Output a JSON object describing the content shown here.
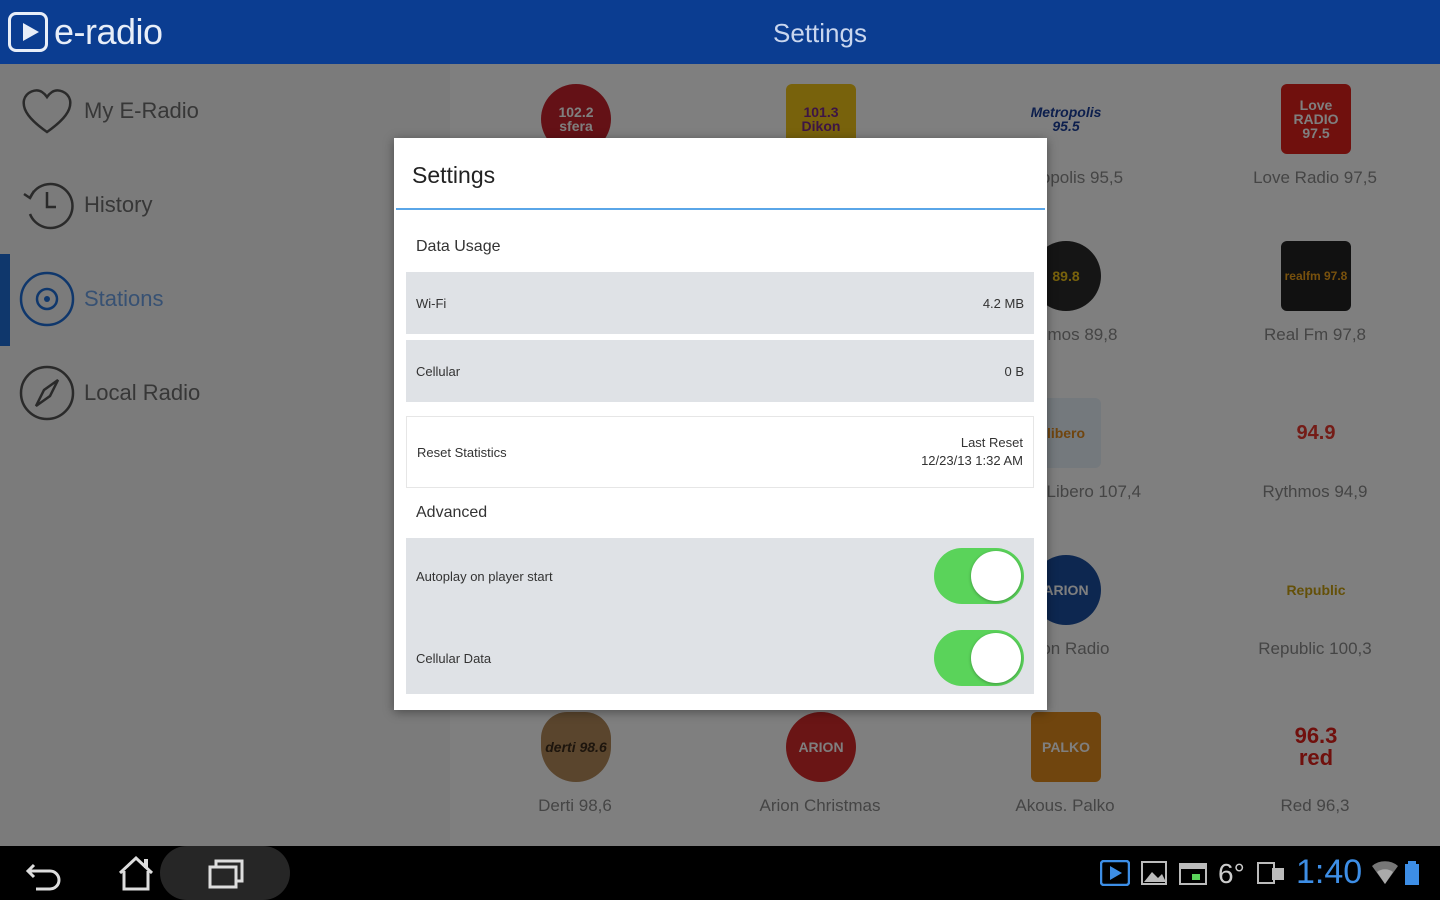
{
  "app": {
    "logo_text": "e-radio",
    "title": "Settings"
  },
  "sidebar": {
    "items": [
      {
        "label": "My E-Radio",
        "icon": "heart-icon",
        "active": false
      },
      {
        "label": "History",
        "icon": "history-icon",
        "active": false
      },
      {
        "label": "Stations",
        "icon": "stations-icon",
        "active": true
      },
      {
        "label": "Local Radio",
        "icon": "compass-icon",
        "active": false
      }
    ]
  },
  "stations": [
    {
      "name": "",
      "logo_text": "102.2 sfera",
      "color": "#c8232c"
    },
    {
      "name": "",
      "logo_text": "101.3 Dikon",
      "color": "#f0c419"
    },
    {
      "name": "Metropolis 95,5",
      "logo_text": "Metropolis 95.5",
      "color": "#ffffff"
    },
    {
      "name": "Love Radio 97,5",
      "logo_text": "Love RADIO 97.5",
      "color": "#e0201a"
    },
    {
      "name": "",
      "logo_text": "",
      "color": "#ffffff"
    },
    {
      "name": "",
      "logo_text": "",
      "color": "#ffffff"
    },
    {
      "name": "Rythmos 89,8",
      "logo_text": "89.8",
      "color": "#2a2a2a"
    },
    {
      "name": "Real Fm 97,8",
      "logo_text": "realfm 97.8",
      "color": "#222222"
    },
    {
      "name": "",
      "logo_text": "",
      "color": "#ffffff"
    },
    {
      "name": "",
      "logo_text": "",
      "color": "#ffffff"
    },
    {
      "name": "Athens Libero 107,4",
      "logo_text": "libero",
      "color": "#7fb3e0"
    },
    {
      "name": "Rythmos 94,9",
      "logo_text": "94.9",
      "color": "#e8392e"
    },
    {
      "name": "",
      "logo_text": "",
      "color": "#ffffff"
    },
    {
      "name": "",
      "logo_text": "",
      "color": "#ffffff"
    },
    {
      "name": "Arion Radio",
      "logo_text": "ARION",
      "color": "#1a4fa0"
    },
    {
      "name": "Republic 100,3",
      "logo_text": "Republic",
      "color": "#f2d31a"
    },
    {
      "name": "Derti 98,6",
      "logo_text": "derti 98.6",
      "color": "#b48a5a"
    },
    {
      "name": "Arion Christmas",
      "logo_text": "ARION",
      "color": "#d42a2a"
    },
    {
      "name": "Akous. Palko",
      "logo_text": "PALKO",
      "color": "#e08a1c"
    },
    {
      "name": "Red 96,3",
      "logo_text": "96.3 red",
      "color": "#ffffff"
    }
  ],
  "dialog": {
    "title": "Settings",
    "data_usage": {
      "section_title": "Data Usage",
      "wifi_label": "Wi-Fi",
      "wifi_value": "4.2 MB",
      "cellular_label": "Cellular",
      "cellular_value": "0 B",
      "reset_label": "Reset Statistics",
      "last_reset_label": "Last Reset",
      "last_reset_value": "12/23/13 1:32 AM"
    },
    "advanced": {
      "section_title": "Advanced",
      "autoplay_label": "Autoplay on player start",
      "autoplay_on": true,
      "cellular_data_label": "Cellular Data",
      "cellular_data_on": true
    }
  },
  "system_bar": {
    "clock": "1:40",
    "notification_count": "6°"
  },
  "colors": {
    "appbar": "#0b3d91",
    "accent": "#1e6fd9",
    "toggle_on": "#5ad35a",
    "clock": "#3d8ee6"
  }
}
